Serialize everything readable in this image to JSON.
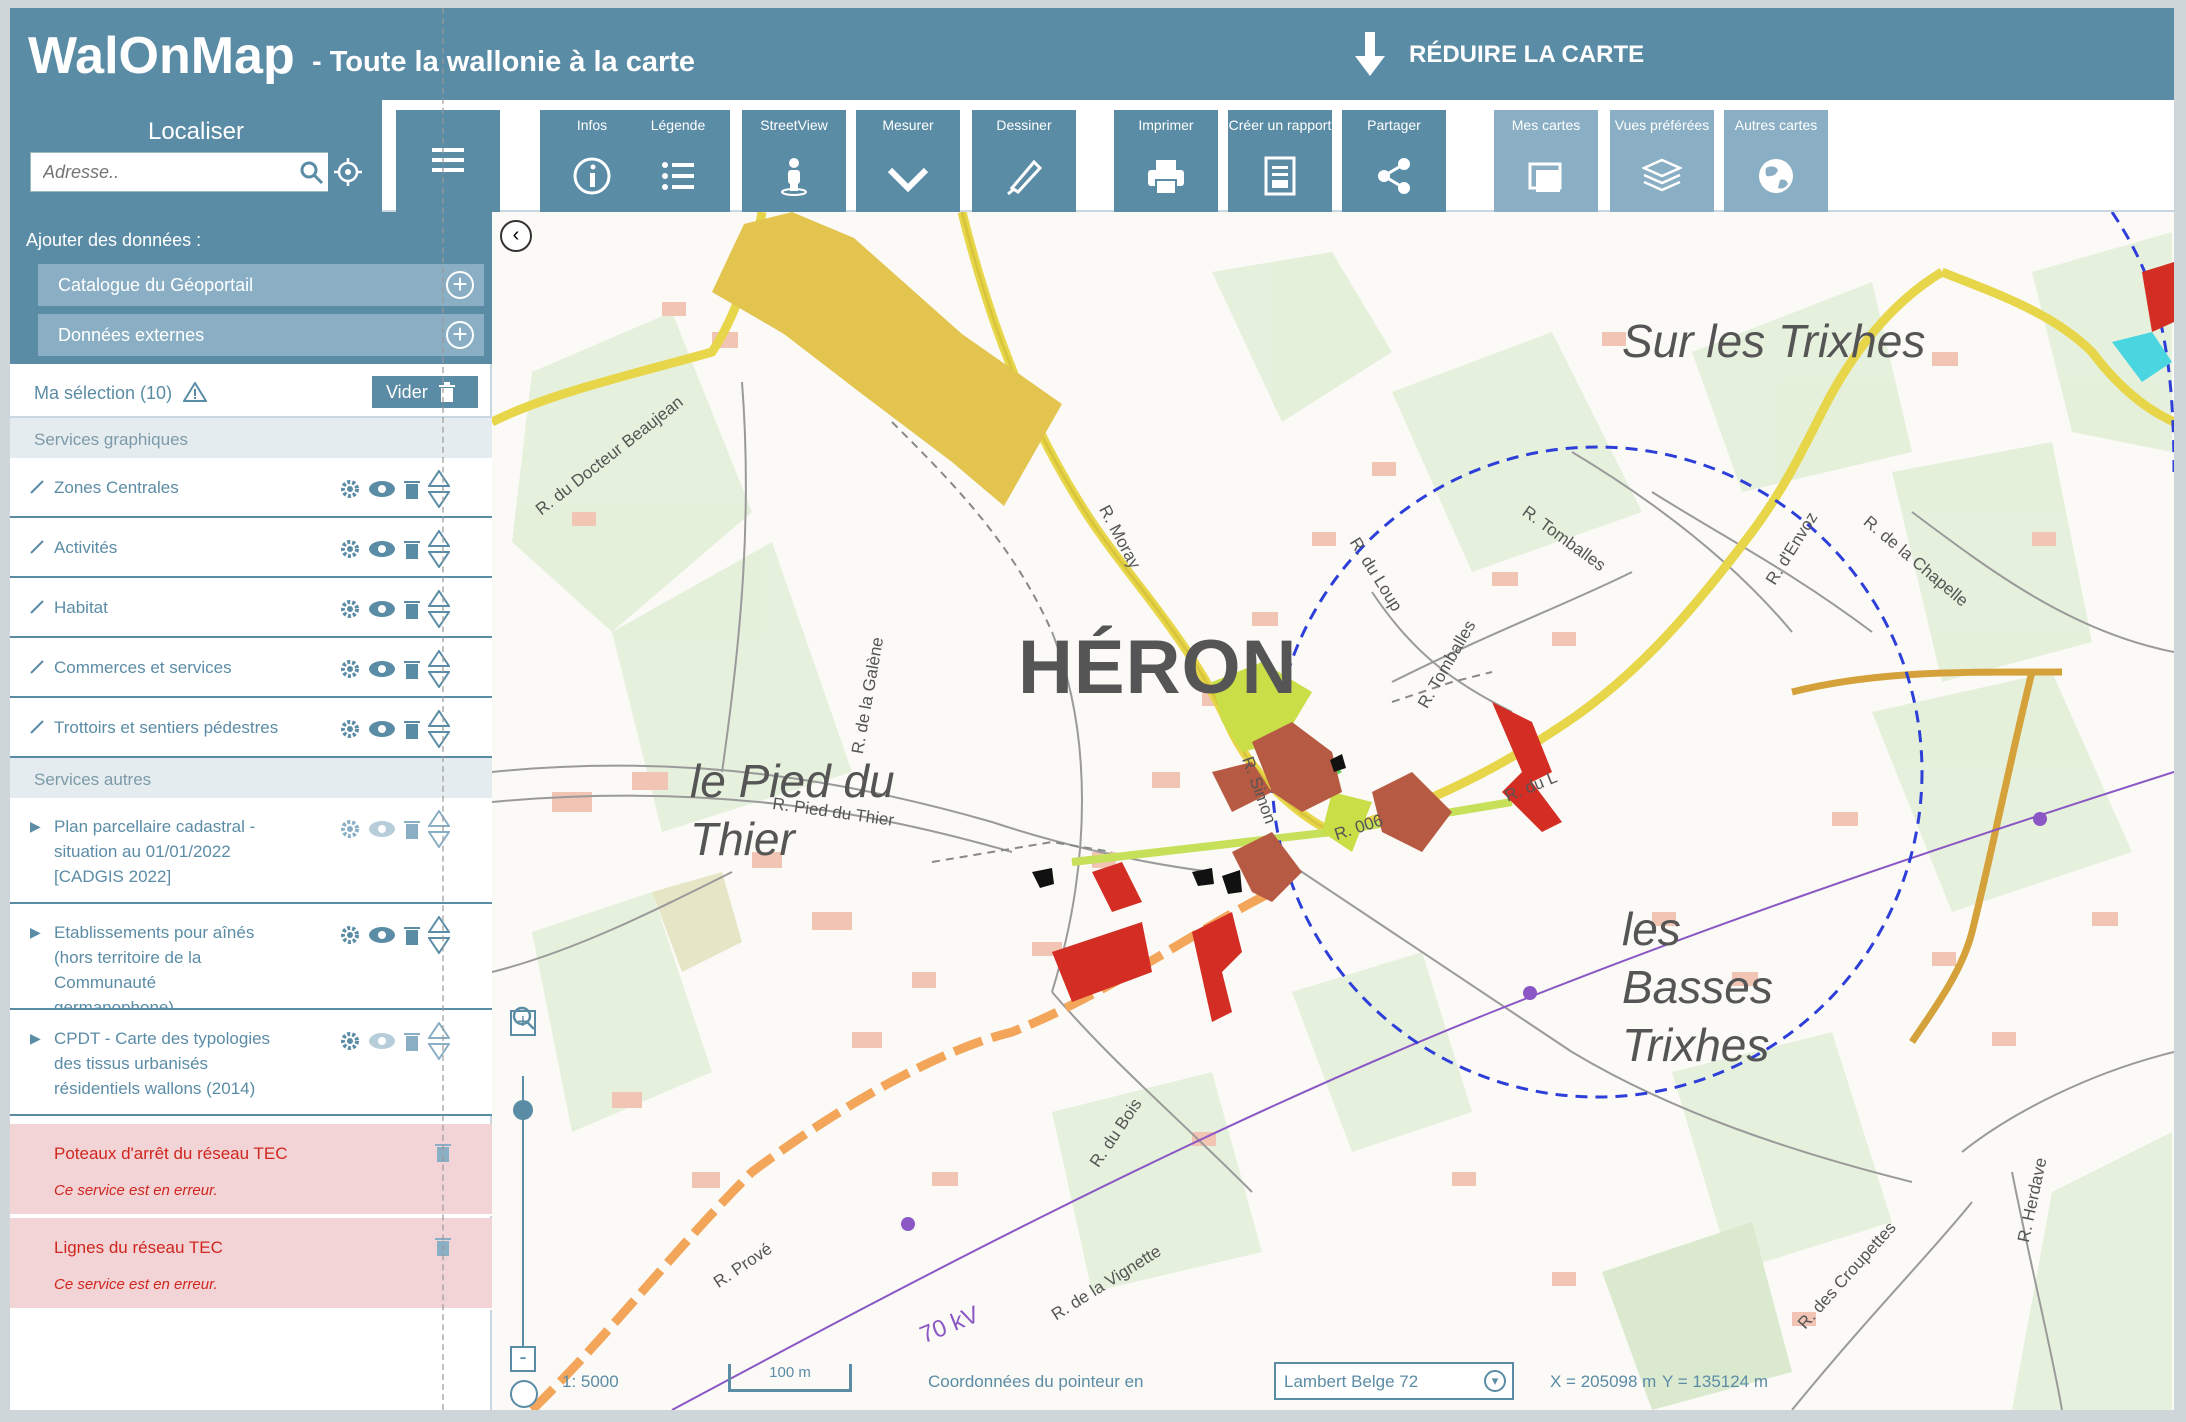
{
  "header": {
    "brand": "WalOnMap",
    "tagline": "- Toute la wallonie à la carte",
    "reduce_label": "RÉDUIRE LA CARTE",
    "reduce_icon": "arrow-down-icon"
  },
  "localize": {
    "label": "Localiser",
    "placeholder": "Adresse..",
    "search_icon": "search-icon",
    "geolocate_icon": "target-icon"
  },
  "toolbar": {
    "menu_icon": "hamburger-icon",
    "buttons": [
      {
        "label": "Infos",
        "icon": "info-icon"
      },
      {
        "label": "Légende",
        "icon": "list-icon"
      },
      {
        "label": "StreetView",
        "icon": "person-icon"
      },
      {
        "label": "Mesurer",
        "icon": "ruler-icon"
      },
      {
        "label": "Dessiner",
        "icon": "pencil-icon"
      },
      {
        "label": "Imprimer",
        "icon": "printer-icon"
      },
      {
        "label": "Créer un rapport",
        "icon": "report-icon"
      },
      {
        "label": "Partager",
        "icon": "share-icon"
      },
      {
        "label": "Mes cartes",
        "icon": "maps-icon"
      },
      {
        "label": "Vues préférées",
        "icon": "layers-icon"
      },
      {
        "label": "Autres cartes",
        "icon": "globe-icon"
      }
    ]
  },
  "sidebar": {
    "add_title": "Ajouter des données :",
    "catalogue": "Catalogue du Géoportail",
    "external": "Données externes",
    "selection": "Ma sélection (10)",
    "clear": "Vider",
    "section_graphic": "Services graphiques",
    "section_other": "Services autres",
    "layers_graphic": [
      {
        "name": "Zones Centrales"
      },
      {
        "name": "Activités"
      },
      {
        "name": "Habitat"
      },
      {
        "name": "Commerces et services"
      },
      {
        "name": "Trottoirs et sentiers pédestres"
      }
    ],
    "layers_other": [
      {
        "name": "Plan parcellaire cadastral - situation au 01/01/2022 [CADGIS 2022]"
      },
      {
        "name": "Etablissements pour aînés (hors territoire de la Communauté germanophone)"
      },
      {
        "name": "CPDT - Carte des typologies des tissus urbanisés résidentiels wallons (2014)"
      }
    ],
    "errors": [
      {
        "name": "Poteaux d'arrêt du réseau TEC",
        "status": "Ce service est en erreur."
      },
      {
        "name": "Lignes du réseau TEC",
        "status": "Ce service est en erreur."
      }
    ]
  },
  "map": {
    "town": "HÉRON",
    "places": {
      "sur_les_trixhes": "Sur les Trixhes",
      "le_pied_du_thier": "le Pied du Thier",
      "les_basses_trixhes": "les Basses Trixhes"
    },
    "streets": {
      "docteur_beaujean": "R. du Docteur Beaujean",
      "galene": "R. de la Galène",
      "moray": "R. Moray",
      "loup": "R. du Loup",
      "tomballes1": "R. Tomballes",
      "tomballes2": "R. Tomballes",
      "envoz": "R. d'Envoz",
      "chapelle": "R. de la Chapelle",
      "simon": "R. Simon",
      "pied_du_thier": "R. Pied du Thier",
      "du_bois": "R. du Bois",
      "vignette": "R. de la Vignette",
      "croupettes": "R. des Croupettes",
      "herdave": "R. Herdave",
      "prove": "R. Prové",
      "du_l": "R. du L"
    },
    "power_line": "70 kV",
    "road_number": "R. 006"
  },
  "status": {
    "scale": "1: 5000",
    "scalebar": "100 m",
    "coord_label": "Coordonnées du pointeur en",
    "projection": "Lambert Belge 72",
    "x": "X = 205098 m",
    "y": "Y = 135124 m"
  },
  "colors": {
    "brand": "#5b8ca6",
    "brand_light": "#8aafc4",
    "error": "#d0261e",
    "error_bg": "#f2d3d6"
  }
}
